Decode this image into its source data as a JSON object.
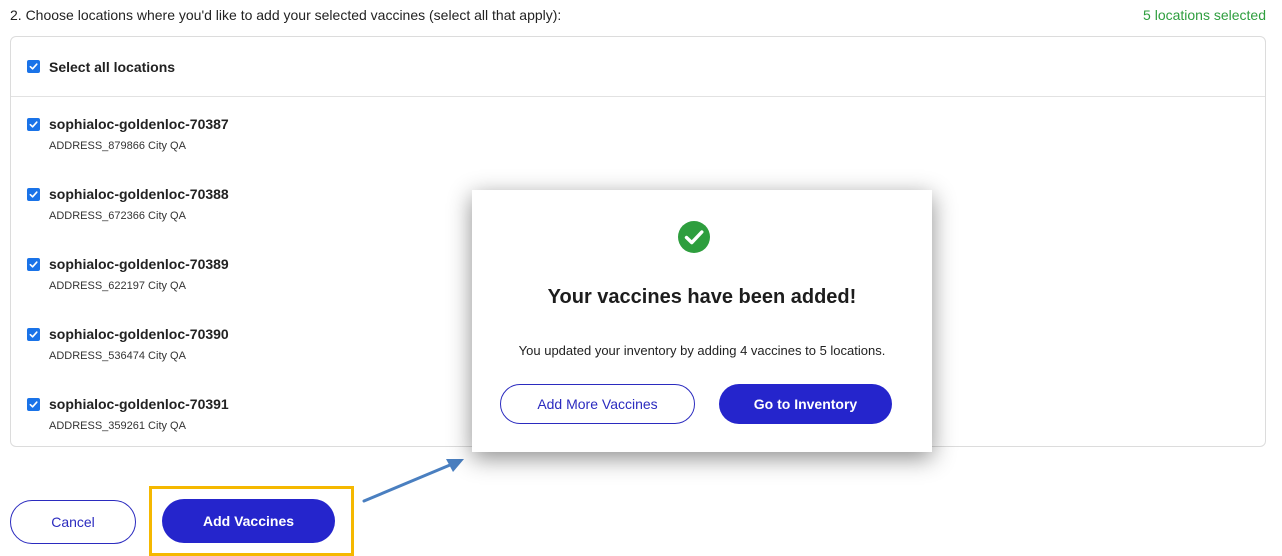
{
  "step": {
    "heading": "2. Choose locations where you'd like to add your selected vaccines (select all that apply):",
    "selected_count": "5 locations selected"
  },
  "select_all": {
    "label": "Select all locations",
    "checked": true
  },
  "locations": [
    {
      "name": "sophialoc-goldenloc-70387",
      "address": "ADDRESS_879866 City QA",
      "checked": true
    },
    {
      "name": "sophialoc-goldenloc-70388",
      "address": "ADDRESS_672366 City QA",
      "checked": true
    },
    {
      "name": "sophialoc-goldenloc-70389",
      "address": "ADDRESS_622197 City QA",
      "checked": true
    },
    {
      "name": "sophialoc-goldenloc-70390",
      "address": "ADDRESS_536474 City QA",
      "checked": true
    },
    {
      "name": "sophialoc-goldenloc-70391",
      "address": "ADDRESS_359261 City QA",
      "checked": true
    }
  ],
  "footer": {
    "cancel_label": "Cancel",
    "add_vaccines_label": "Add Vaccines"
  },
  "modal": {
    "icon": "check-circle-icon",
    "title": "Your vaccines have been added!",
    "message": "You updated your inventory by adding 4 vaccines to 5 locations.",
    "add_more_label": "Add More Vaccines",
    "go_inventory_label": "Go to Inventory"
  },
  "colors": {
    "accent": "#2525cc",
    "success": "#2e9e3e",
    "checkbox": "#1a73e8",
    "highlight": "#f5b800",
    "arrow": "#4a7fc0"
  }
}
